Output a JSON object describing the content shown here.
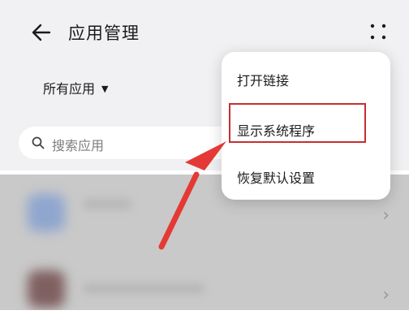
{
  "header": {
    "title": "应用管理",
    "back_icon": "arrow-left-icon",
    "more_icon": "more-dots-icon"
  },
  "filter": {
    "label": "所有应用",
    "caret": "▼"
  },
  "search": {
    "placeholder": "搜索应用",
    "icon": "search-icon"
  },
  "menu": {
    "items": [
      {
        "label": "打开链接"
      },
      {
        "label": "显示系统程序"
      },
      {
        "label": "恢复默认设置"
      }
    ],
    "highlight_color": "#c62e31"
  },
  "list": {
    "chevron": "›"
  },
  "colors": {
    "header_bg": "#f1f1f3",
    "dim_bg": "#c9c9c9",
    "arrow": "#e53935"
  }
}
